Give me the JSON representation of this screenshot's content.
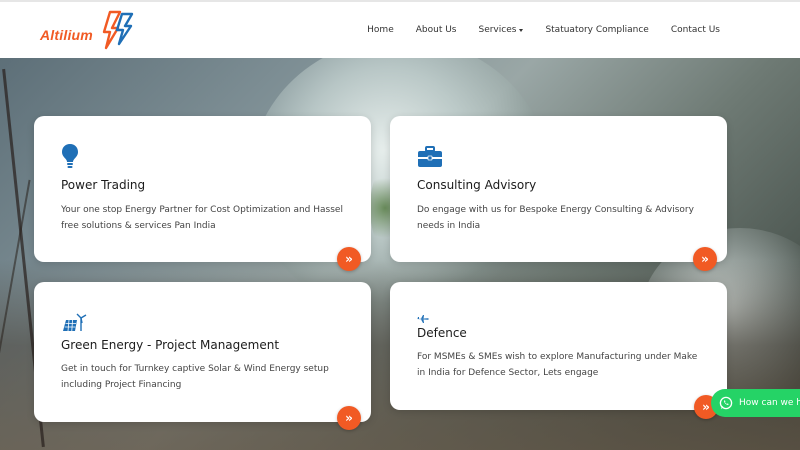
{
  "brand": {
    "name": "Altilium",
    "primary_color": "#f15a24",
    "secondary_color": "#1f6fb6"
  },
  "nav": {
    "items": [
      {
        "label": "Home",
        "has_dropdown": false
      },
      {
        "label": "About Us",
        "has_dropdown": false
      },
      {
        "label": "Services",
        "has_dropdown": true
      },
      {
        "label": "Statuatory Compliance",
        "has_dropdown": false
      },
      {
        "label": "Contact Us",
        "has_dropdown": false
      }
    ]
  },
  "cards": [
    {
      "icon": "lightbulb-icon",
      "title": "Power Trading",
      "description": "Your one stop Energy Partner for Cost Optimization and Hassel free solutions & services Pan India"
    },
    {
      "icon": "briefcase-icon",
      "title": "Consulting Advisory",
      "description": "Do engage with us for Bespoke Energy Consulting & Advisory needs in India"
    },
    {
      "icon": "solar-wind-icon",
      "title": "Green Energy - Project Management",
      "description": "Get in touch for Turnkey captive Solar & Wind Energy setup including Project Financing"
    },
    {
      "icon": "jet-icon",
      "title": "Defence",
      "description": "For MSMEs & SMEs wish to explore Manufacturing under Make in India for Defence Sector, Lets engage"
    }
  ],
  "arrow_glyph": "»",
  "whatsapp": {
    "label": "How can we h",
    "color": "#25d366"
  }
}
